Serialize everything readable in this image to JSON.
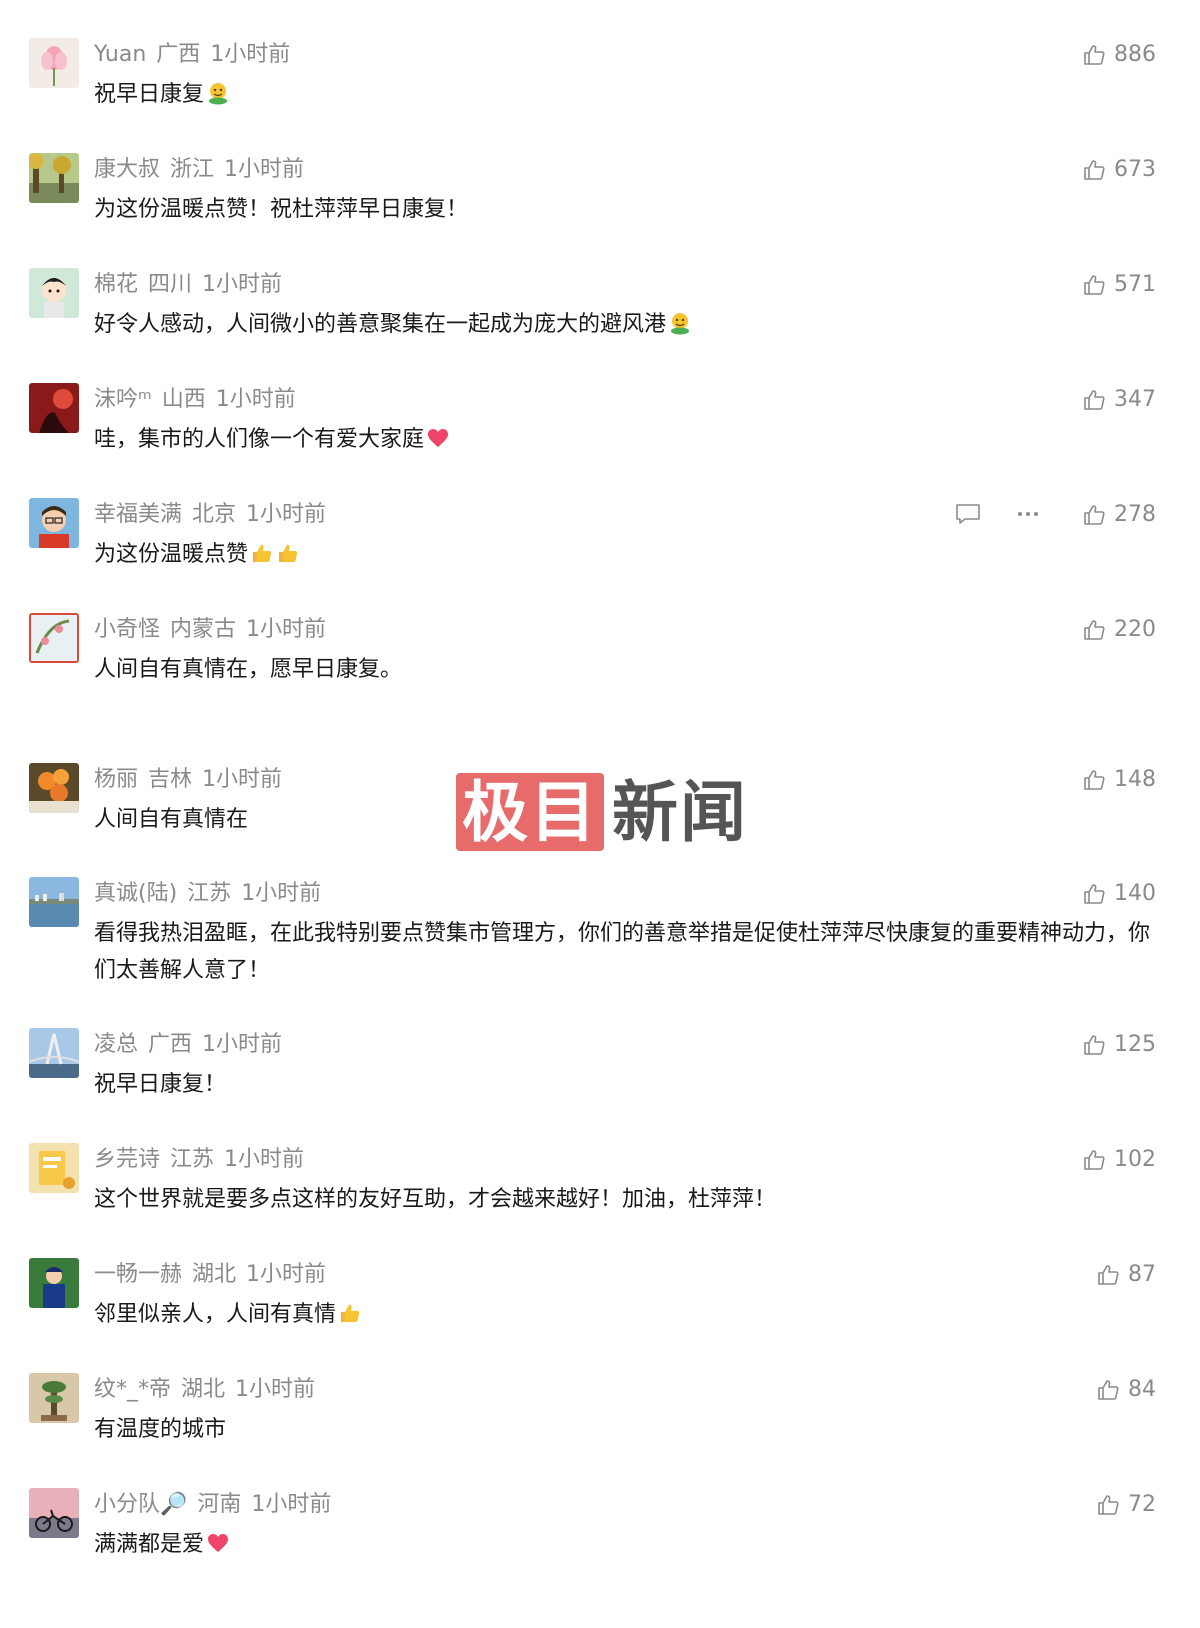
{
  "comments": [
    {
      "user": "Yuan",
      "region": "广西",
      "time": "1小时前",
      "text": "祝早日康复",
      "emoji": "hug",
      "likes": "886",
      "avatar": "lotus-avatar"
    },
    {
      "user": "康大叔",
      "region": "浙江",
      "time": "1小时前",
      "text": "为这份温暖点赞！祝杜萍萍早日康复！",
      "emoji": "",
      "likes": "673",
      "avatar": "street-avatar"
    },
    {
      "user": "棉花",
      "region": "四川",
      "time": "1小时前",
      "text": "好令人感动，人间微小的善意聚集在一起成为庞大的避风港",
      "emoji": "hug",
      "likes": "571",
      "avatar": "cartoon-avatar"
    },
    {
      "user": "沫吟ᵐ",
      "region": "山西",
      "time": "1小时前",
      "text": "哇，集市的人们像一个有爱大家庭",
      "emoji": "heart",
      "likes": "347",
      "avatar": "red-avatar"
    },
    {
      "user": "幸福美满",
      "region": "北京",
      "time": "1小时前",
      "text": "为这份温暖点赞",
      "emoji": "thumbs2",
      "likes": "278",
      "avatar": "child-avatar"
    },
    {
      "user": "小奇怪",
      "region": "内蒙古",
      "time": "1小时前",
      "text": "人间自有真情在，愿早日康复。",
      "emoji": "",
      "likes": "220",
      "avatar": "flower-avatar"
    },
    {
      "user": "杨丽",
      "region": "吉林",
      "time": "1小时前",
      "text": "人间自有真情在",
      "emoji": "",
      "likes": "148",
      "avatar": "orange-flower-avatar"
    },
    {
      "user": "真诚(陆)",
      "region": "江苏",
      "time": "1小时前",
      "text": "看得我热泪盈眶，在此我特别要点赞集市管理方，你们的善意举措是促使杜萍萍尽快康复的重要精神动力，你们太善解人意了！",
      "emoji": "",
      "likes": "140",
      "avatar": "lake-avatar"
    },
    {
      "user": "凌总",
      "region": "广西",
      "time": "1小时前",
      "text": "祝早日康复！",
      "emoji": "",
      "likes": "125",
      "avatar": "bridge-avatar"
    },
    {
      "user": "乡芫诗",
      "region": "江苏",
      "time": "1小时前",
      "text": "这个世界就是要多点这样的友好互助，才会越来越好！加油，杜萍萍！",
      "emoji": "",
      "likes": "102",
      "avatar": "yellow-avatar"
    },
    {
      "user": "一畅一赫",
      "region": "湖北",
      "time": "1小时前",
      "text": "邻里似亲人，人间有真情",
      "emoji": "thumbs1",
      "likes": "87",
      "avatar": "boy-avatar"
    },
    {
      "user": "纹*_*帝",
      "region": "湖北",
      "time": "1小时前",
      "text": "有温度的城市",
      "emoji": "",
      "likes": "84",
      "avatar": "plant-avatar"
    },
    {
      "user": "小分队🔎",
      "region": "河南",
      "time": "1小时前",
      "text": "满满都是爱",
      "emoji": "heart",
      "likes": "72",
      "avatar": "bike-avatar"
    }
  ],
  "watermark": {
    "brand_box": "极目",
    "brand_text": "新闻"
  },
  "colors": {
    "meta": "#8a8a8a",
    "text": "#1a1a1a",
    "watermark_red": "#e86b6b"
  }
}
